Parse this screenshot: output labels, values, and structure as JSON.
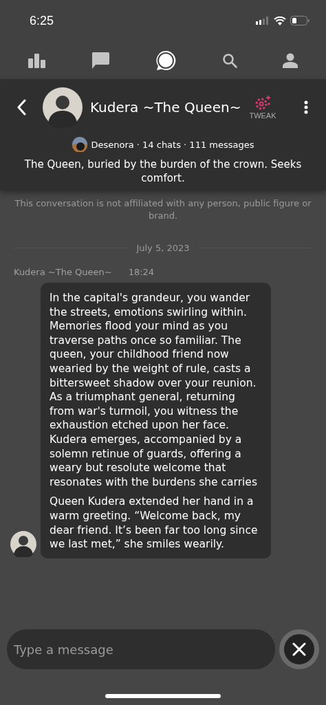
{
  "status_bar": {
    "time": "6:25"
  },
  "nav_tabs": [
    {
      "kind": "stats",
      "selected": false
    },
    {
      "kind": "chats",
      "selected": false
    },
    {
      "kind": "chai",
      "selected": true
    },
    {
      "kind": "search",
      "selected": false
    },
    {
      "kind": "profile",
      "selected": false
    }
  ],
  "header": {
    "title": "Kudera ~The Queen~",
    "tweak_label": "TWEAK",
    "creator": "Desenora",
    "stats": "· 14 chats · 111 messages",
    "description": "The Queen, buried by the burden of the crown. Seeks comfort."
  },
  "disclaimer": [
    "This conversation is not affiliated with any person, public figure or brand."
  ],
  "date": "July 5, 2023",
  "messages": [
    {
      "sender": "Kudera ~The Queen~",
      "time": "18:24",
      "paragraphs": [
        "In the capital's grandeur, you wander the streets, emotions swirling within. Memories flood your mind as you traverse paths once so familiar. The queen, your childhood friend now wearied by the weight of rule, casts a bittersweet shadow over your reunion. As a triumphant general, returning from war's turmoil, you witness the exhaustion etched upon her face. Kudera emerges, accompanied by a solemn retinue of guards, offering a weary but resolute welcome that resonates with the burdens she carries",
        "Queen Kudera extended her hand in a warm greeting. “Welcome back, my dear friend. It’s been far too long since we last met,” she smiles wearily."
      ]
    }
  ],
  "composer": {
    "placeholder": "Type a message"
  }
}
